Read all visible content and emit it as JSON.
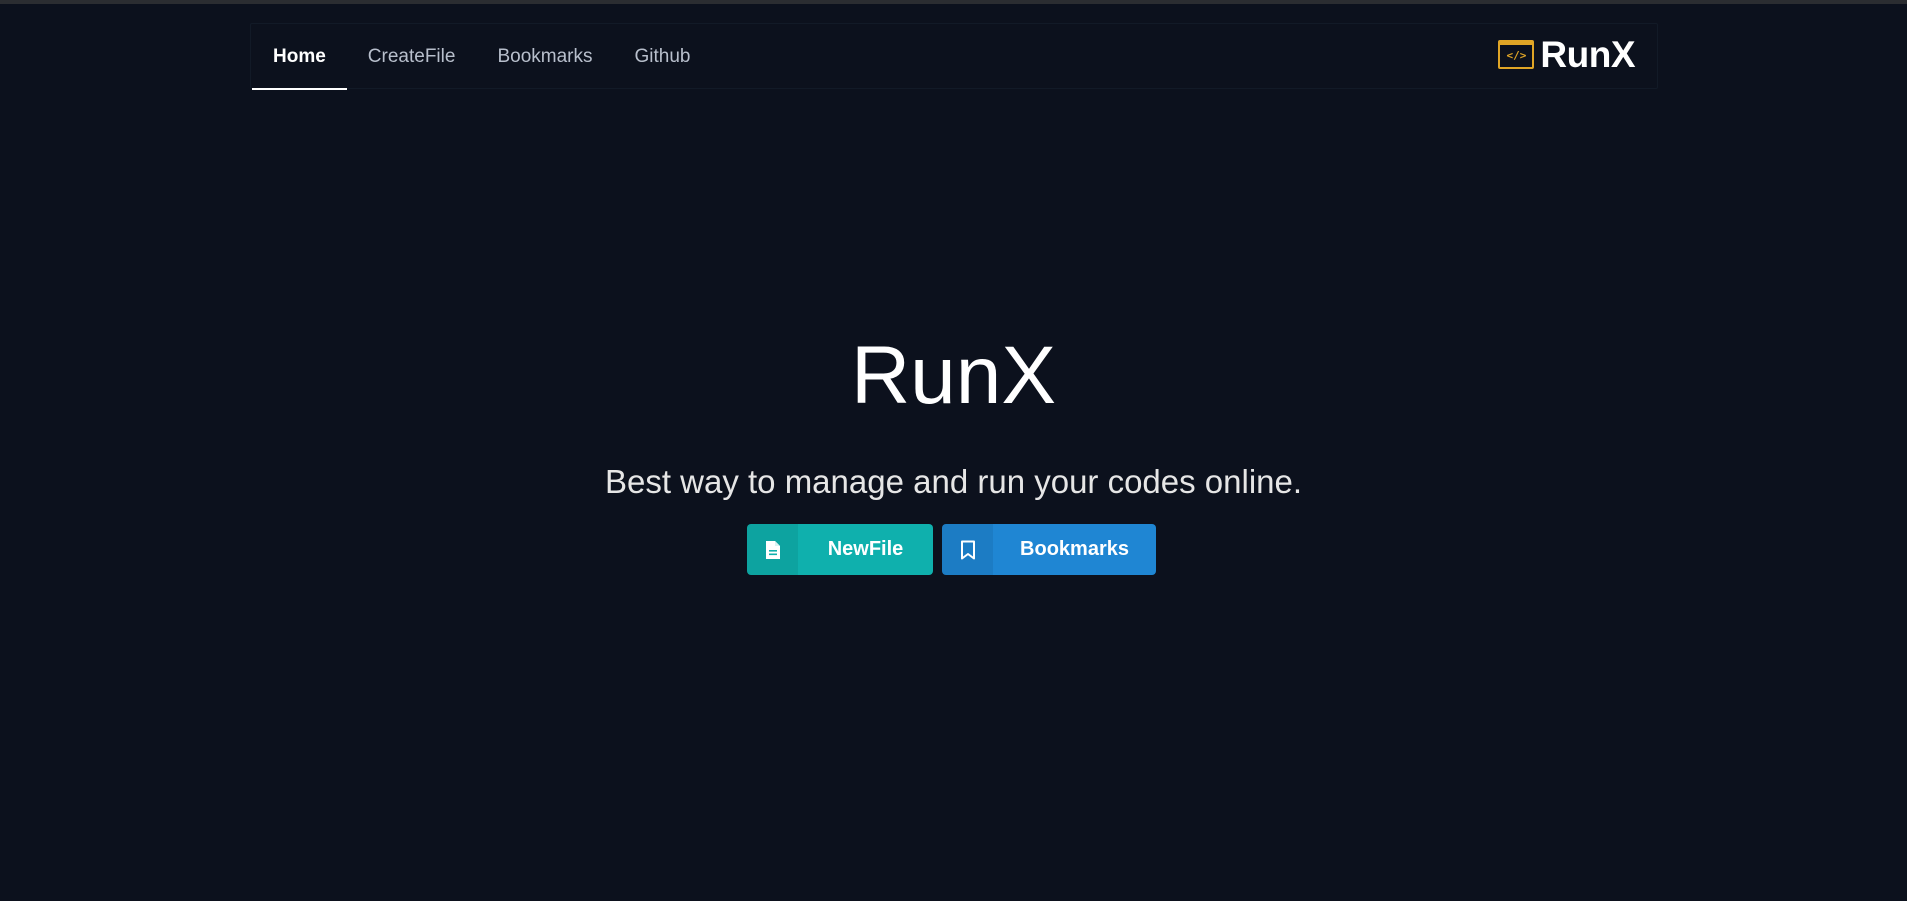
{
  "nav": {
    "tabs": [
      {
        "label": "Home",
        "active": true
      },
      {
        "label": "CreateFile",
        "active": false
      },
      {
        "label": "Bookmarks",
        "active": false
      },
      {
        "label": "Github",
        "active": false
      }
    ],
    "brand": {
      "icon": "code-window-icon",
      "icon_glyph": "</>",
      "name": "RunX"
    }
  },
  "hero": {
    "title": "RunX",
    "subtitle": "Best way to manage and run your codes online.",
    "buttons": [
      {
        "label": "NewFile",
        "icon": "file-icon",
        "color": "#0fb0ad"
      },
      {
        "label": "Bookmarks",
        "icon": "bookmark-icon",
        "color": "#1f86d3"
      }
    ]
  },
  "colors": {
    "background": "#0c111d",
    "brand_accent": "#e0a526"
  }
}
